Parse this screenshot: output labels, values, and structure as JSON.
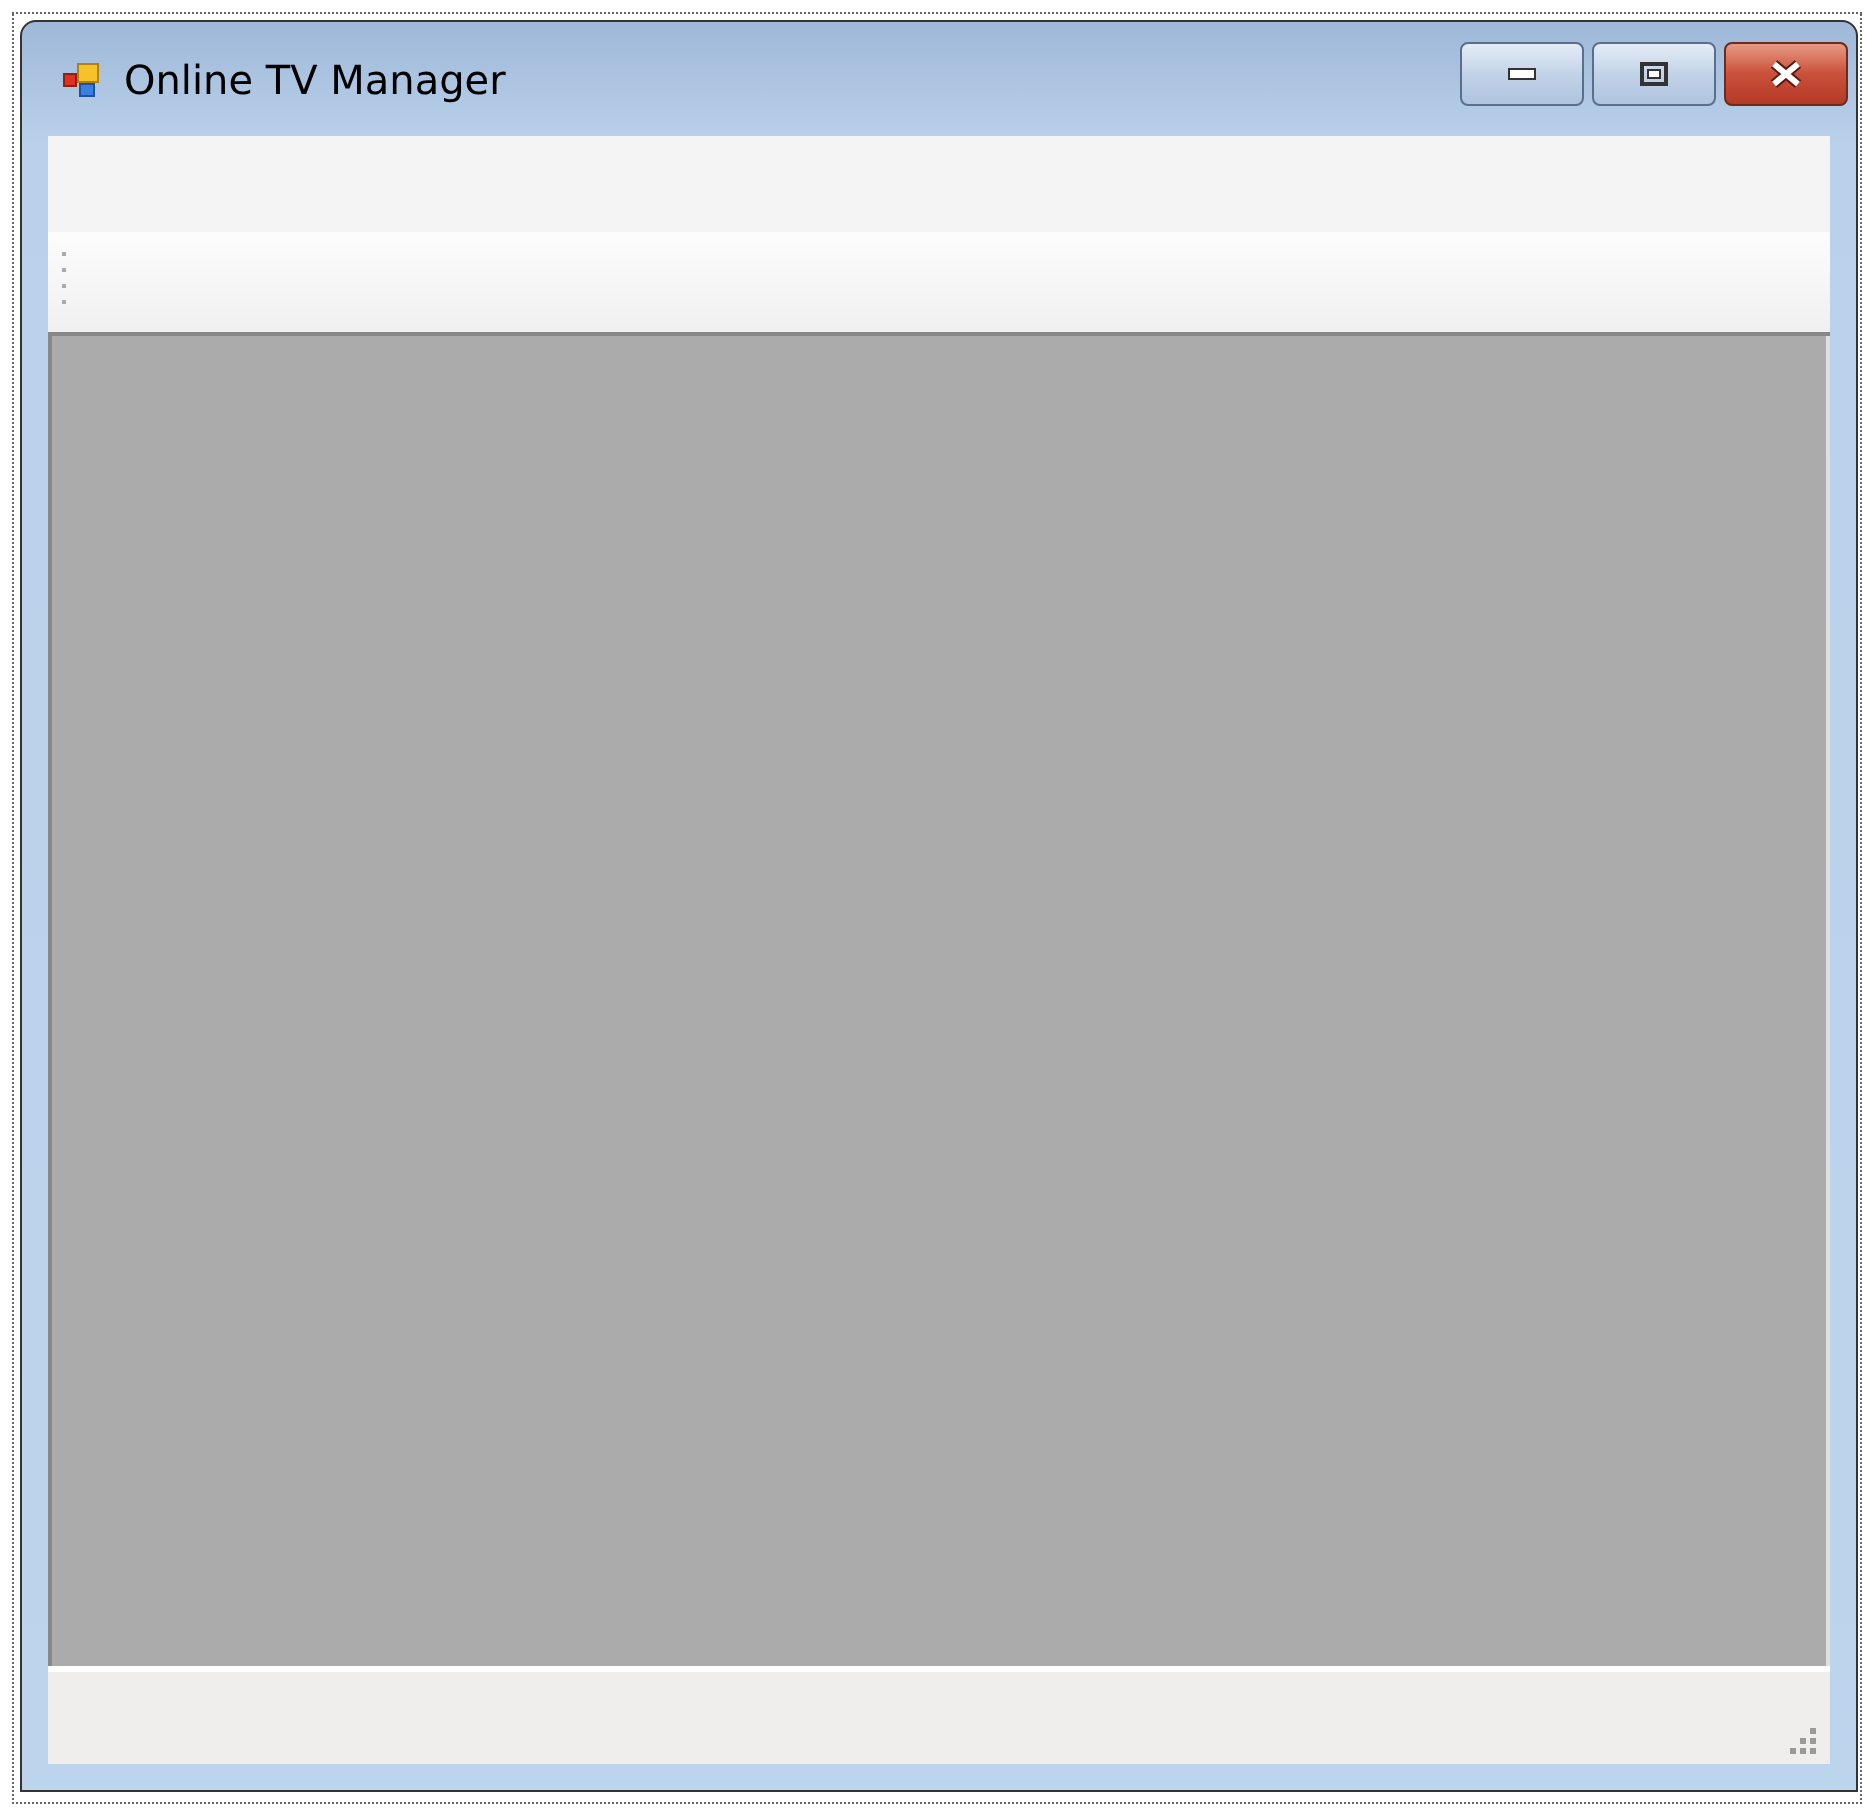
{
  "window": {
    "title": "Online TV Manager"
  }
}
